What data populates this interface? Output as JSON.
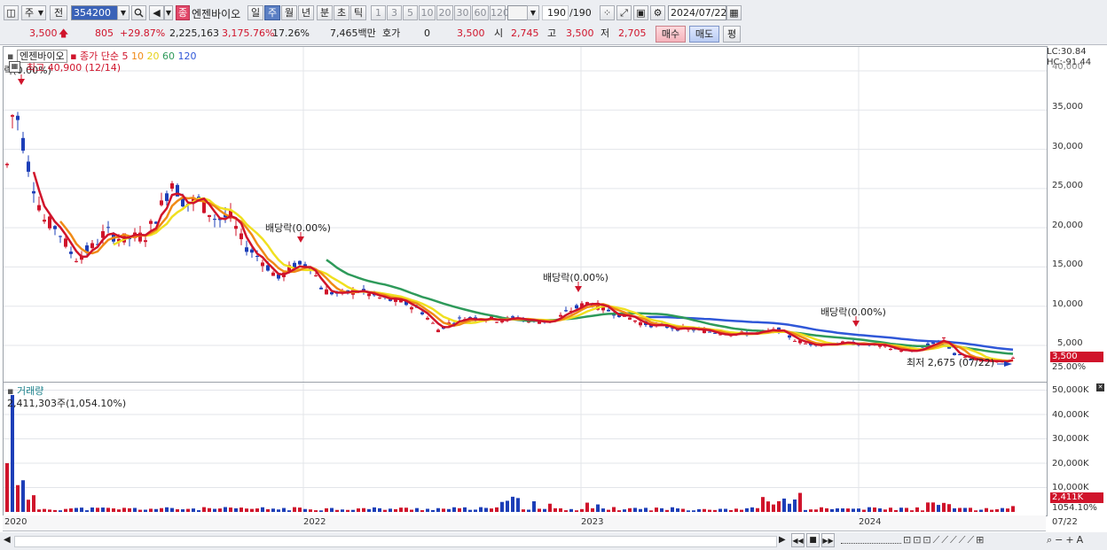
{
  "toolbar": {
    "period_label": "주",
    "prev_label": "전",
    "code_value": "354200",
    "stock_tag": "종",
    "stock_name": "엔젠바이오",
    "period_buttons": [
      "일",
      "주",
      "월",
      "년",
      "분",
      "초",
      "틱"
    ],
    "selected_period": "주",
    "tick_buttons": [
      "1",
      "3",
      "5",
      "10",
      "20",
      "30",
      "60",
      "120"
    ],
    "count_value": "190",
    "count_total": "/190",
    "date_value": "2024/07/22"
  },
  "quote": {
    "price": "3,500",
    "change": "805",
    "change_pct": "+29.87%",
    "volume": "2,225,163",
    "volume_ratio": "3,175.76%",
    "turnover": "17.26%",
    "amount": "7,465백만",
    "hoga_label": "호가",
    "hoga_value": "0",
    "hoga_price": "3,500",
    "open_label": "시",
    "open_value": "2,745",
    "high_label": "고",
    "high_value": "3,500",
    "low_label": "저",
    "low_value": "2,705",
    "buy_label": "매수",
    "sell_label": "매도",
    "eval_label": "평"
  },
  "price_panel": {
    "stock_name": "엔젠바이오",
    "ma_label": "종가 단순",
    "ma_periods": [
      "5",
      "10",
      "20",
      "60",
      "120"
    ],
    "ma_colors": [
      "#d0142b",
      "#f08a16",
      "#f0e020",
      "#2e9a5a",
      "#2f57d8"
    ],
    "high_note": "최고 40,900 (12/14)",
    "low_note": "최저 2,675 (07/22)",
    "lc_text": "LC:30.84",
    "hc_text": "HC:-91.44",
    "dividends": [
      "배당락(0.00%)",
      "배당락(0.00%)",
      "배당락(0.00%)",
      "배당락(0.00%)"
    ],
    "y_labels": [
      "40,000",
      "35,000",
      "30,000",
      "25,000",
      "20,000",
      "15,000",
      "10,000",
      "5,000"
    ],
    "price_tag": "3,500",
    "pct_tag": "25.00%"
  },
  "volume_panel": {
    "title": "거래량",
    "value_text": "2,411,303주(1,054.10%)",
    "y_labels": [
      "50,000K",
      "40,000K",
      "30,000K",
      "20,000K",
      "10,000K"
    ],
    "volume_tag": "2,411K",
    "pct_tag": "1054.10%"
  },
  "x_axis": {
    "labels": [
      "2020",
      "2022",
      "2023",
      "2024"
    ],
    "end_label": "07/22"
  },
  "chart_data": {
    "type": "candlestick",
    "x_range": [
      "2020-12",
      "2024-07"
    ],
    "y_range": [
      2500,
      40900
    ],
    "moving_averages": [
      "5",
      "10",
      "20",
      "60",
      "120"
    ],
    "annotations": [
      "최고 40,900 (12/14)",
      "최저 2,675 (07/22)",
      "배당락(0.00%)"
    ],
    "last_close": 3500
  }
}
